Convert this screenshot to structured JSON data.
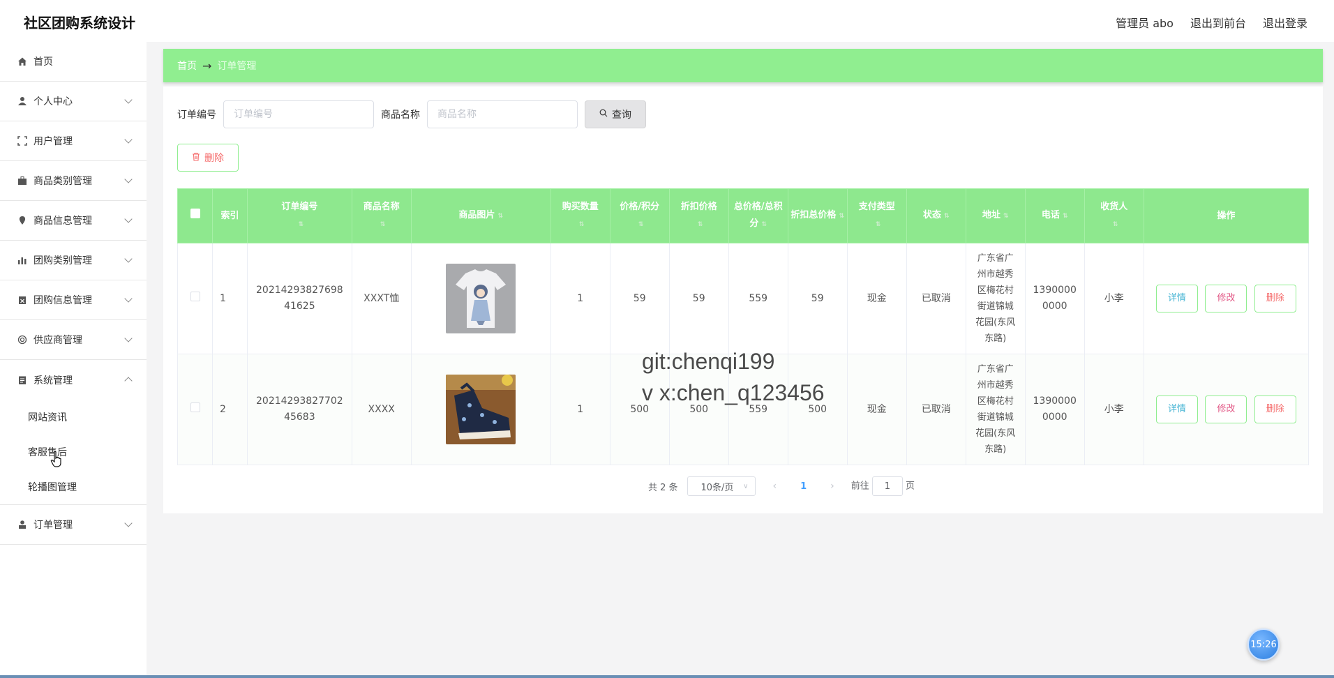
{
  "header": {
    "app_title": "社区团购系统设计",
    "admin_label": "管理员 abo",
    "to_front": "退出到前台",
    "logout": "退出登录"
  },
  "sidebar": {
    "items": [
      {
        "label": "首页",
        "icon": "home-icon"
      },
      {
        "label": "个人中心",
        "icon": "user-icon"
      },
      {
        "label": "用户管理",
        "icon": "frame-icon"
      },
      {
        "label": "商品类别管理",
        "icon": "briefcase-icon"
      },
      {
        "label": "商品信息管理",
        "icon": "location-icon"
      },
      {
        "label": "团购类别管理",
        "icon": "chart-icon"
      },
      {
        "label": "团购信息管理",
        "icon": "clipboard-icon"
      },
      {
        "label": "供应商管理",
        "icon": "target-icon"
      },
      {
        "label": "系统管理",
        "icon": "document-icon"
      },
      {
        "label": "订单管理",
        "icon": "person-icon"
      }
    ],
    "system_sub": [
      "网站资讯",
      "客服售后",
      "轮播图管理"
    ]
  },
  "breadcrumb": {
    "home": "首页",
    "arrow": "→",
    "current": "订单管理"
  },
  "search": {
    "order_no_label": "订单编号",
    "order_no_placeholder": "订单编号",
    "goods_name_label": "商品名称",
    "goods_name_placeholder": "商品名称",
    "query_button": "查询",
    "delete_button": "删除"
  },
  "table": {
    "headers": {
      "index": "索引",
      "order_no": "订单编号",
      "goods_name": "商品名称",
      "goods_image": "商品图片",
      "qty": "购买数量",
      "price": "价格/积分",
      "discount_price": "折扣价格",
      "total": "总价格/总积分",
      "discount_total": "折扣总价格",
      "pay_type": "支付类型",
      "status": "状态",
      "address": "地址",
      "phone": "电话",
      "receiver": "收货人",
      "ops": "操作"
    },
    "rows": [
      {
        "index": "1",
        "order_no": "20214293827698 41625",
        "goods_name": "XXXT恤",
        "image": "tshirt-image",
        "qty": "1",
        "price": "59",
        "discount_price": "59",
        "total": "559",
        "discount_total": "59",
        "pay_type": "现金",
        "status": "已取消",
        "address": "广东省广州市越秀区梅花村街道锦城花园(东风东路)",
        "phone": "13900000000",
        "receiver": "小李"
      },
      {
        "index": "2",
        "order_no": "20214293827702 45683",
        "goods_name": "XXXX",
        "image": "sneaker-image",
        "qty": "1",
        "price": "500",
        "discount_price": "500",
        "total": "559",
        "discount_total": "500",
        "pay_type": "现金",
        "status": "已取消",
        "address": "广东省广州市越秀区梅花村街道锦城花园(东风东路)",
        "phone": "13900000000",
        "receiver": "小李"
      }
    ],
    "ops": {
      "detail": "详情",
      "edit": "修改",
      "delete": "删除"
    }
  },
  "pagination": {
    "total": "共 2 条",
    "page_size": "10条/页",
    "current": "1",
    "goto_label": "前往",
    "goto_value": "1",
    "page_unit": "页"
  },
  "watermark": {
    "line1": "git:chenqi199",
    "line2": "v x:chen_q123456"
  },
  "clock": "15:26",
  "colors": {
    "accent": "#90ee90",
    "header_bg": "#8ee88e",
    "danger": "#f56c6c"
  }
}
